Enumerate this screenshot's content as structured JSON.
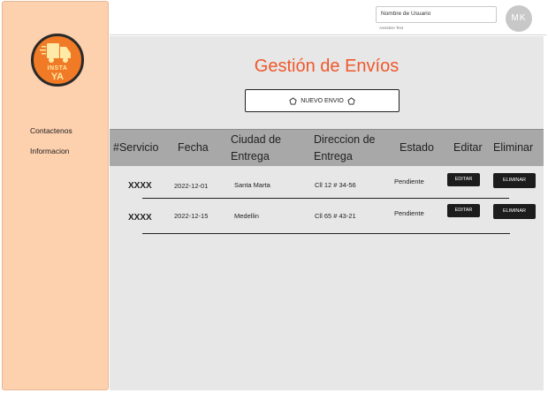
{
  "sidebar": {
    "logo": {
      "line1": "INSTA",
      "line2": "YA"
    },
    "items": [
      {
        "label": "Contactenos"
      },
      {
        "label": "Informacion"
      }
    ]
  },
  "header": {
    "username_label": "Nombre de Usuario",
    "assistive_text": "Assistive Text",
    "avatar_initials": "MK"
  },
  "main": {
    "title": "Gestión de Envíos",
    "new_button_label": "NUEVO ENVIO",
    "columns": [
      "#Servicio",
      "Fecha",
      "Ciudad de Entrega",
      "Direccion de Entrega",
      "Estado",
      "Editar",
      "Eliminar"
    ],
    "rows": [
      {
        "id": "XXXX",
        "fecha": "2022-12-01",
        "ciudad": "Santa Marta",
        "direccion": "Cll 12 # 34-56",
        "estado": "Pendiente",
        "editar": "EDITAR",
        "eliminar": "ELIMINAR"
      },
      {
        "id": "XXXX",
        "fecha": "2022-12-15",
        "ciudad": "Medellin",
        "direccion": "Cll 65 # 43-21",
        "estado": "Pendiente",
        "editar": "EDITAR",
        "eliminar": "ELIMINAR"
      }
    ]
  },
  "colors": {
    "sidebar_bg": "#fdd0ae",
    "title": "#f0582b",
    "logo": "#f07a25",
    "table_header": "#a8a8a8",
    "action_button": "#1c1c1c"
  }
}
